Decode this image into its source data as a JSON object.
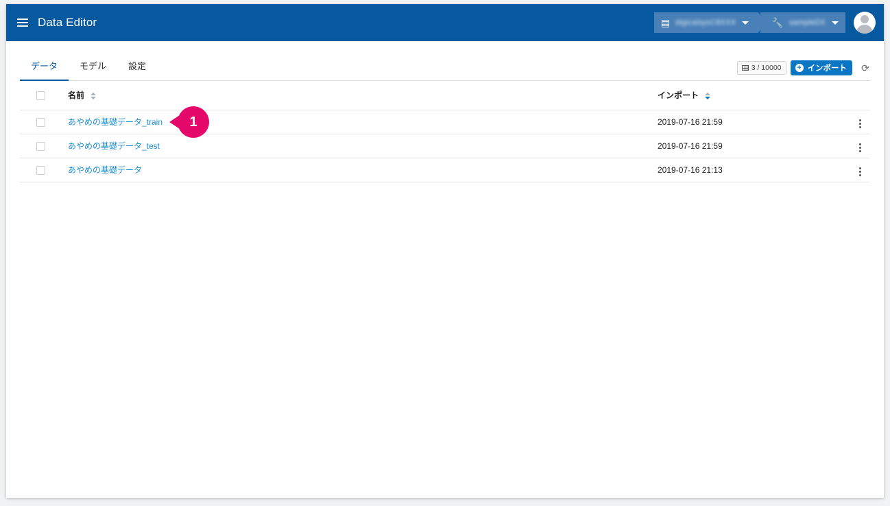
{
  "header": {
    "app_title": "Data Editor",
    "org_name": "digicalsysC8XXX",
    "project_name": "sampleDX"
  },
  "tabs": [
    {
      "label": "データ",
      "active": true
    },
    {
      "label": "モデル",
      "active": false
    },
    {
      "label": "設定",
      "active": false
    }
  ],
  "toolbar": {
    "count": "3 / 10000",
    "import_label": "インポート"
  },
  "table": {
    "columns": {
      "name": "名前",
      "import": "インポート"
    },
    "rows": [
      {
        "name": "あやめの基礎データ_train",
        "imported": "2019-07-16 21:59"
      },
      {
        "name": "あやめの基礎データ_test",
        "imported": "2019-07-16 21:59"
      },
      {
        "name": "あやめの基礎データ",
        "imported": "2019-07-16 21:13"
      }
    ]
  },
  "callout": {
    "number": "1",
    "color": "#e4086b"
  },
  "colors": {
    "header": "#06599f",
    "accent": "#0b76c4",
    "link": "#1a8fd6"
  }
}
